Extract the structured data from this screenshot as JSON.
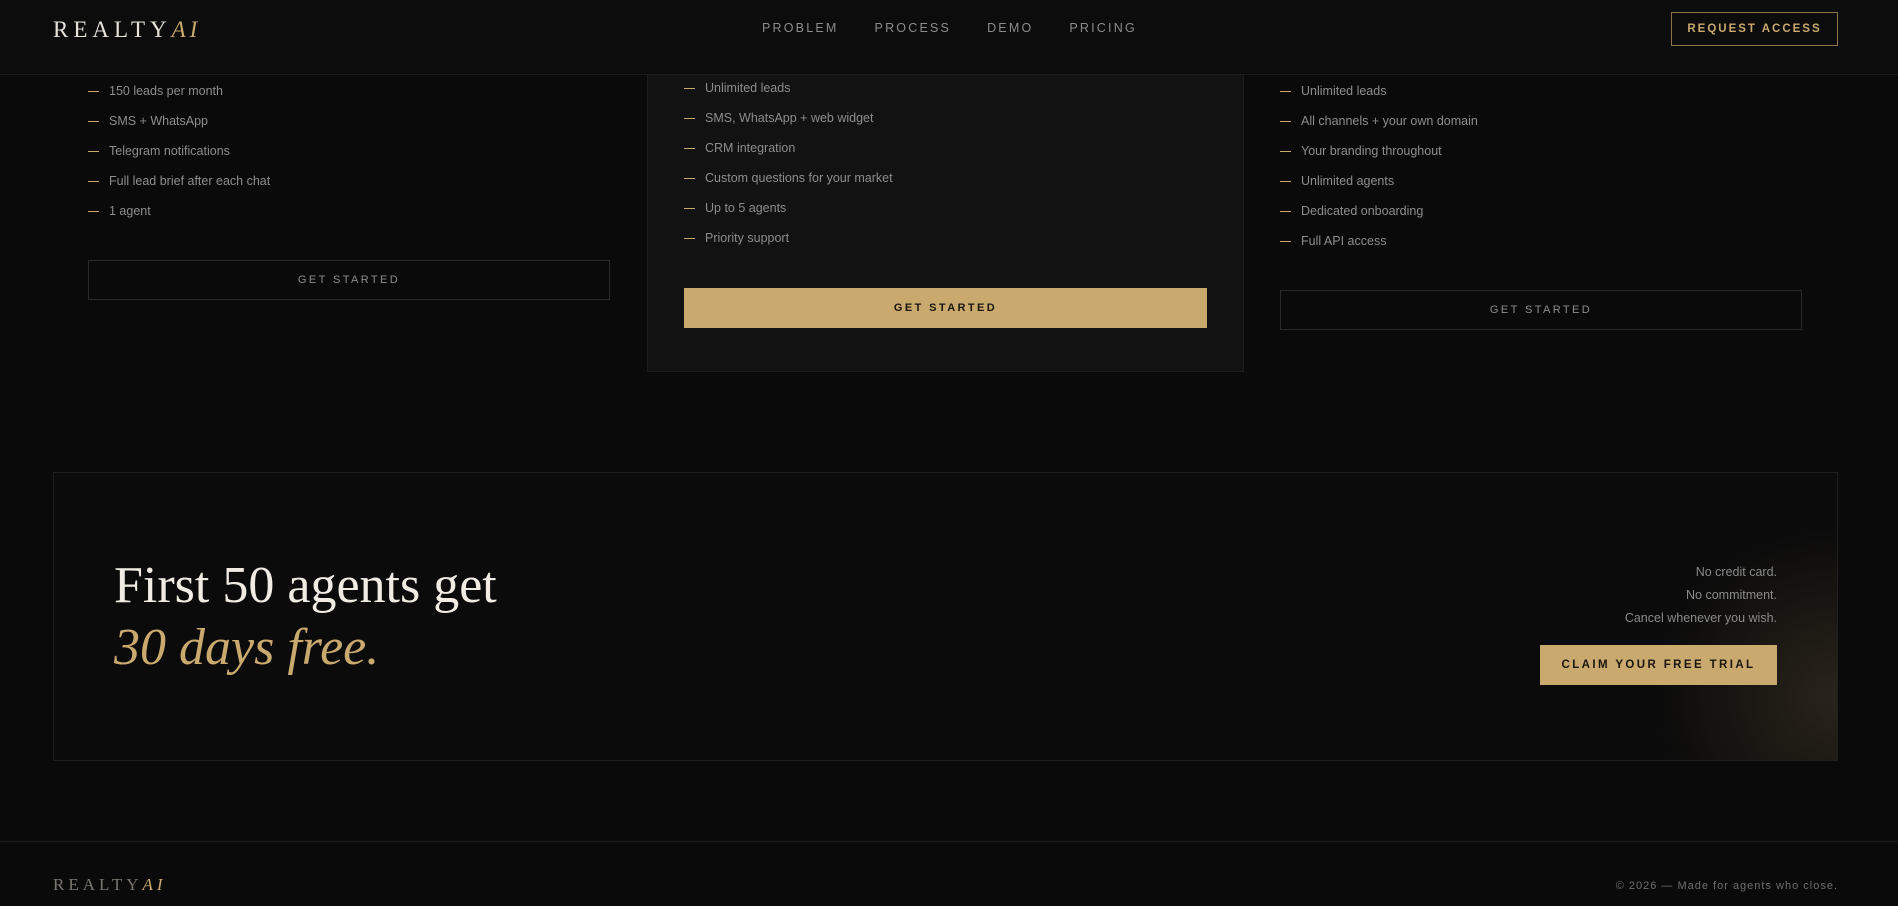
{
  "header": {
    "logo_main": "REALTY",
    "logo_accent": "AI",
    "nav": [
      "PROBLEM",
      "PROCESS",
      "DEMO",
      "PRICING"
    ],
    "cta_label": "REQUEST ACCESS"
  },
  "plans": [
    {
      "features": [
        "150 leads per month",
        "SMS + WhatsApp",
        "Telegram notifications",
        "Full lead brief after each chat",
        "1 agent"
      ],
      "button_label": "GET STARTED"
    },
    {
      "features": [
        "Unlimited leads",
        "SMS, WhatsApp + web widget",
        "CRM integration",
        "Custom questions for your market",
        "Up to 5 agents",
        "Priority support"
      ],
      "button_label": "GET STARTED"
    },
    {
      "features": [
        "Unlimited leads",
        "All channels + your own domain",
        "Your branding throughout",
        "Unlimited agents",
        "Dedicated onboarding",
        "Full API access"
      ],
      "button_label": "GET STARTED"
    }
  ],
  "cta": {
    "title_line1": "First 50 agents get",
    "title_line2": "30 days free.",
    "notes": [
      "No credit card.",
      "No commitment.",
      "Cancel whenever you wish."
    ],
    "button_label": "CLAIM YOUR FREE TRIAL"
  },
  "footer": {
    "logo_main": "REALTY",
    "logo_accent": "AI",
    "copyright": "© 2026 — Made for agents who close."
  },
  "colors": {
    "background": "#0a0a0a",
    "accent_gold": "#c9a96e",
    "text_muted": "#8a8a8a"
  }
}
